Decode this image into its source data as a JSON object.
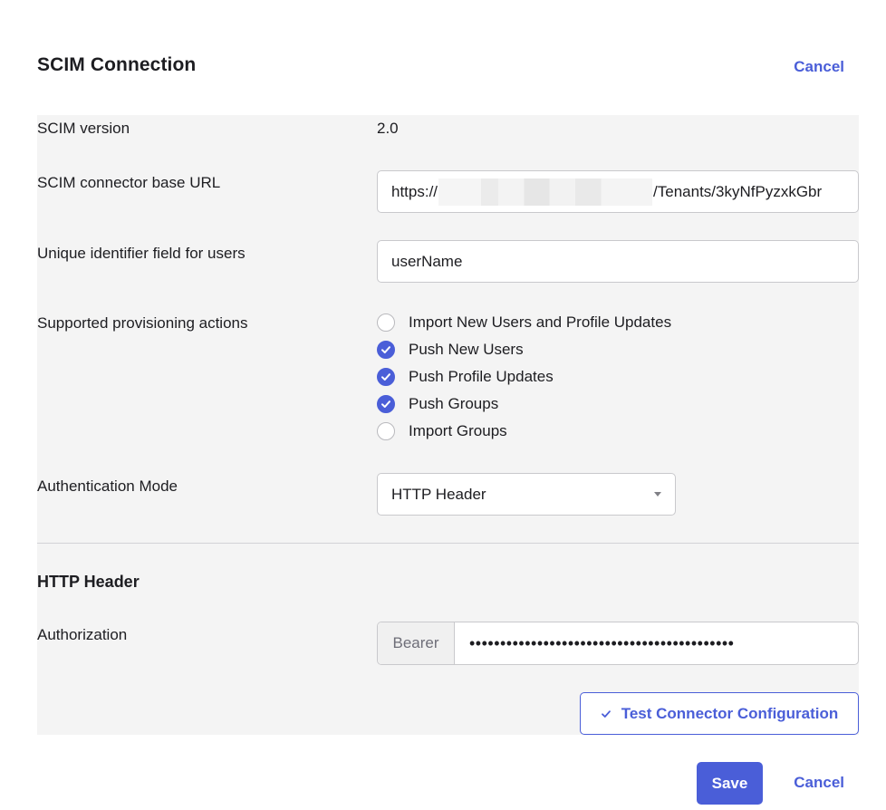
{
  "header": {
    "title": "SCIM Connection",
    "cancel_label": "Cancel"
  },
  "fields": {
    "scim_version": {
      "label": "SCIM version",
      "value": "2.0"
    },
    "base_url": {
      "label": "SCIM connector base URL",
      "prefix": "https://",
      "suffix": "/Tenants/3kyNfPyzxkGbr"
    },
    "unique_id": {
      "label": "Unique identifier field for users",
      "value": "userName"
    },
    "provisioning": {
      "label": "Supported provisioning actions",
      "options": [
        {
          "label": "Import New Users and Profile Updates",
          "checked": false
        },
        {
          "label": "Push New Users",
          "checked": true
        },
        {
          "label": "Push Profile Updates",
          "checked": true
        },
        {
          "label": "Push Groups",
          "checked": true
        },
        {
          "label": "Import Groups",
          "checked": false
        }
      ]
    },
    "auth_mode": {
      "label": "Authentication Mode",
      "value": "HTTP Header"
    }
  },
  "http_header": {
    "heading": "HTTP Header",
    "authorization_label": "Authorization",
    "prefix": "Bearer",
    "token_masked": "•••••••••••••••••••••••••••••••••••••••••••"
  },
  "actions": {
    "test_label": "Test Connector Configuration",
    "save_label": "Save",
    "cancel_label": "Cancel"
  },
  "colors": {
    "accent": "#4a5ed8",
    "panel_bg": "#f4f4f4"
  }
}
